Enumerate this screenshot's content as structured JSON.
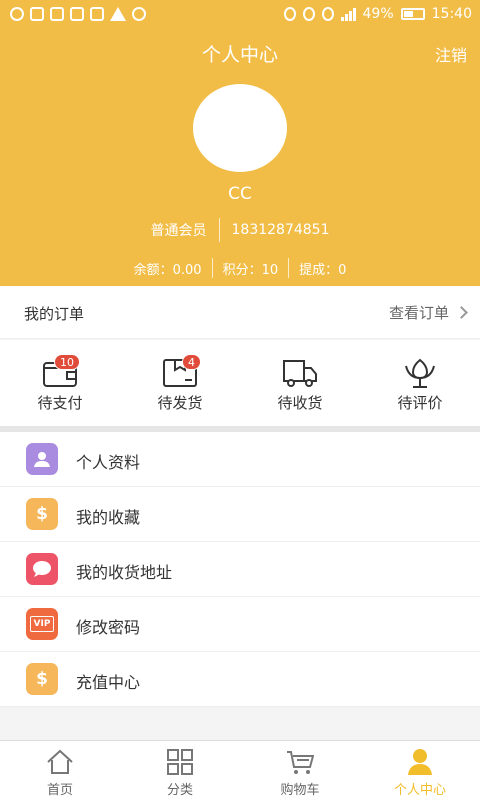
{
  "status_bar": {
    "battery": "49%",
    "time": "15:40"
  },
  "header": {
    "title": "个人中心",
    "logout_label": "注销",
    "username": "CC",
    "member_level": "普通会员",
    "phone": "18312874851",
    "balance_label": "余额：0.00",
    "points_label": "积分：10",
    "commission_label": "提成：0"
  },
  "orders": {
    "title": "我的订单",
    "view_all_label": "查看订单",
    "items": [
      {
        "label": "待支付",
        "badge": "10",
        "icon": "wallet-icon"
      },
      {
        "label": "待发货",
        "badge": "4",
        "icon": "box-icon"
      },
      {
        "label": "待收货",
        "badge": "",
        "icon": "truck-icon"
      },
      {
        "label": "待评价",
        "badge": "",
        "icon": "flower-icon"
      }
    ]
  },
  "menu": {
    "items": [
      {
        "label": "个人资料",
        "icon": "user-profile-icon",
        "color": "#a98be0",
        "glyph": "👤"
      },
      {
        "label": "我的收藏",
        "icon": "dollar-icon",
        "color": "#f5b75a",
        "glyph": "$"
      },
      {
        "label": "我的收货地址",
        "icon": "chat-bubble-icon",
        "color": "#ee5468",
        "glyph": "💬"
      },
      {
        "label": "修改密码",
        "icon": "vip-card-icon",
        "color": "#ef6a3e",
        "glyph": "VIP"
      },
      {
        "label": "充值中心",
        "icon": "dollar-icon",
        "color": "#f5b75a",
        "glyph": "$"
      }
    ]
  },
  "bottom_nav": {
    "items": [
      {
        "label": "首页",
        "icon": "home-icon",
        "active": false
      },
      {
        "label": "分类",
        "icon": "grid-icon",
        "active": false
      },
      {
        "label": "购物车",
        "icon": "cart-icon",
        "active": false
      },
      {
        "label": "个人中心",
        "icon": "person-icon",
        "active": true
      }
    ]
  },
  "colors": {
    "brand": "#f2bd47",
    "active": "#f2bd2a",
    "badge": "#e04b3a"
  }
}
